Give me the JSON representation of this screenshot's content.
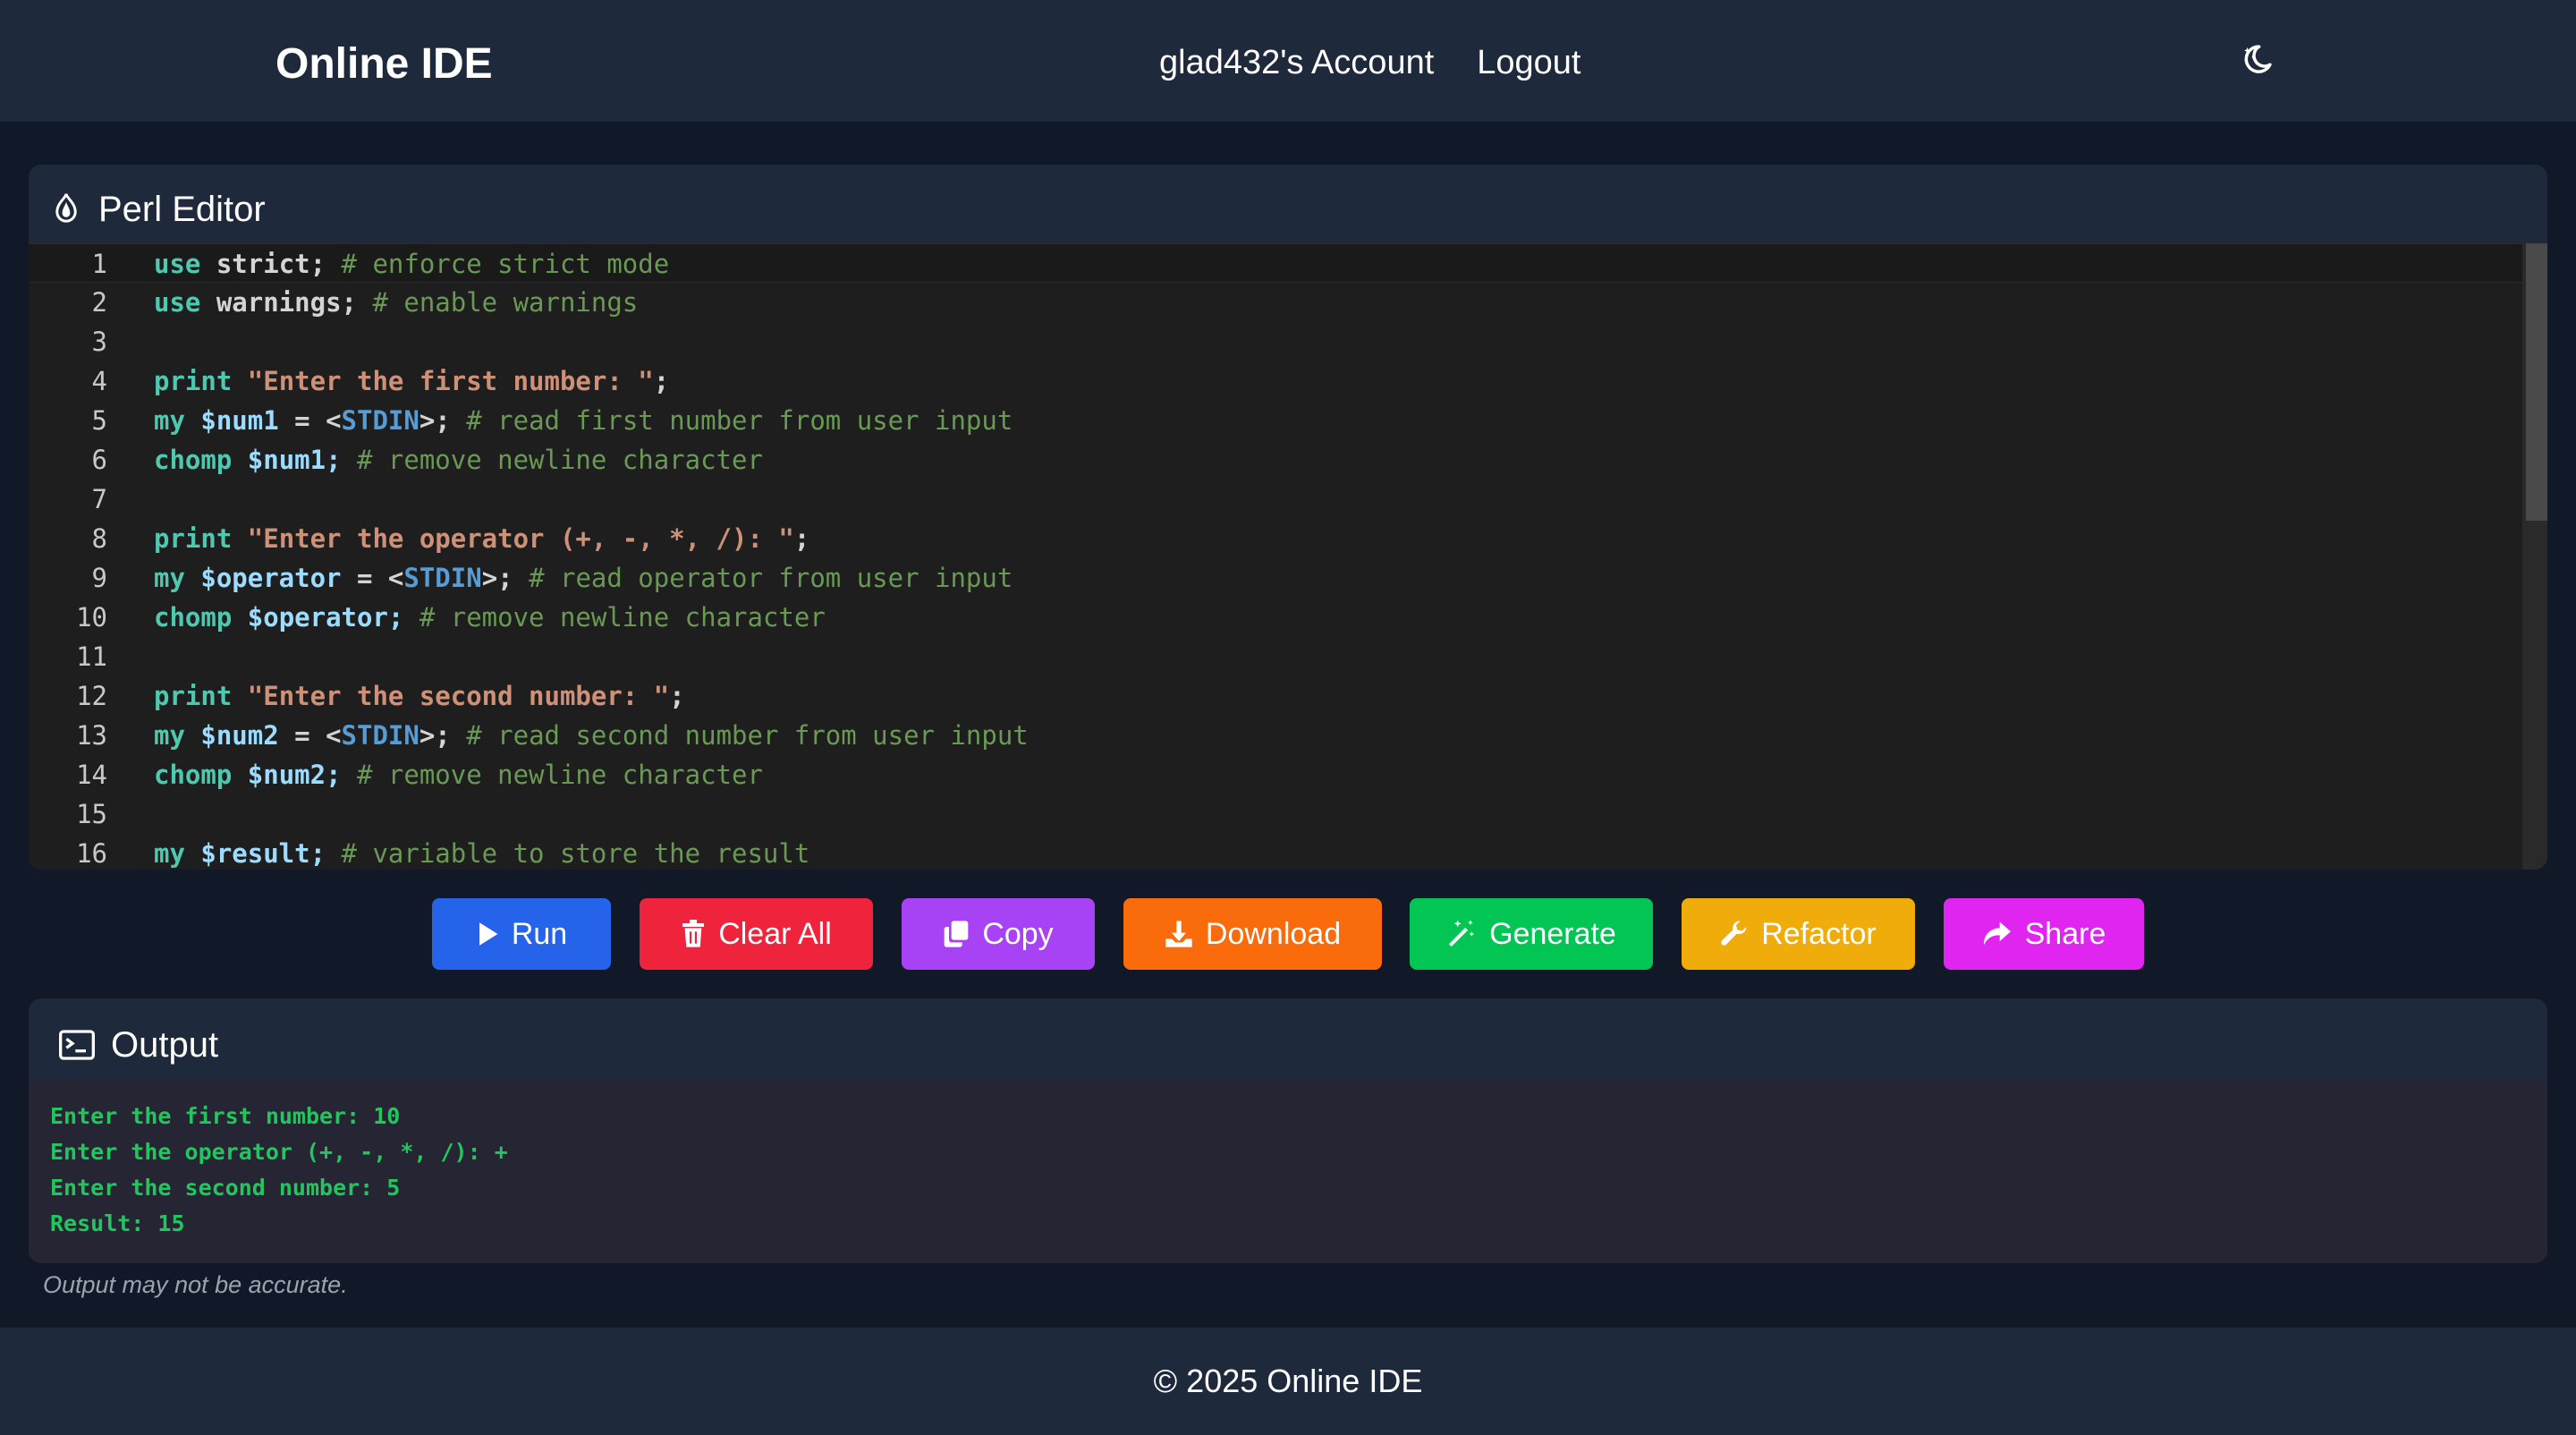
{
  "header": {
    "brand": "Online IDE",
    "account_link": "glad432's Account",
    "logout_link": "Logout",
    "theme_icon": "moon-stars-icon"
  },
  "editor": {
    "title": "Perl Editor",
    "title_icon": "perl-onion-icon",
    "lines": [
      {
        "num": "1",
        "tokens": [
          {
            "t": "use",
            "c": "kw"
          },
          {
            "t": " strict;",
            "c": "plain"
          },
          {
            "t": " # enforce strict mode",
            "c": "cmt"
          }
        ]
      },
      {
        "num": "2",
        "tokens": [
          {
            "t": "use",
            "c": "kw"
          },
          {
            "t": " warnings;",
            "c": "plain"
          },
          {
            "t": " # enable warnings",
            "c": "cmt"
          }
        ]
      },
      {
        "num": "3",
        "tokens": []
      },
      {
        "num": "4",
        "tokens": [
          {
            "t": "print",
            "c": "kw"
          },
          {
            "t": " \"Enter the first number: \"",
            "c": "str"
          },
          {
            "t": ";",
            "c": "plain"
          }
        ]
      },
      {
        "num": "5",
        "tokens": [
          {
            "t": "my",
            "c": "kw"
          },
          {
            "t": " $num1",
            "c": "var"
          },
          {
            "t": " = <",
            "c": "plain"
          },
          {
            "t": "STDIN",
            "c": "fh"
          },
          {
            "t": ">;",
            "c": "plain"
          },
          {
            "t": " # read first number from user input",
            "c": "cmt"
          }
        ]
      },
      {
        "num": "6",
        "tokens": [
          {
            "t": "chomp",
            "c": "kw"
          },
          {
            "t": " $num1;",
            "c": "var"
          },
          {
            "t": " # remove newline character",
            "c": "cmt"
          }
        ]
      },
      {
        "num": "7",
        "tokens": []
      },
      {
        "num": "8",
        "tokens": [
          {
            "t": "print",
            "c": "kw"
          },
          {
            "t": " \"Enter the operator (+, -, *, /): \"",
            "c": "str"
          },
          {
            "t": ";",
            "c": "plain"
          }
        ]
      },
      {
        "num": "9",
        "tokens": [
          {
            "t": "my",
            "c": "kw"
          },
          {
            "t": " $operator",
            "c": "var"
          },
          {
            "t": " = <",
            "c": "plain"
          },
          {
            "t": "STDIN",
            "c": "fh"
          },
          {
            "t": ">;",
            "c": "plain"
          },
          {
            "t": " # read operator from user input",
            "c": "cmt"
          }
        ]
      },
      {
        "num": "10",
        "tokens": [
          {
            "t": "chomp",
            "c": "kw"
          },
          {
            "t": " $operator;",
            "c": "var"
          },
          {
            "t": " # remove newline character",
            "c": "cmt"
          }
        ]
      },
      {
        "num": "11",
        "tokens": []
      },
      {
        "num": "12",
        "tokens": [
          {
            "t": "print",
            "c": "kw"
          },
          {
            "t": " \"Enter the second number: \"",
            "c": "str"
          },
          {
            "t": ";",
            "c": "plain"
          }
        ]
      },
      {
        "num": "13",
        "tokens": [
          {
            "t": "my",
            "c": "kw"
          },
          {
            "t": " $num2",
            "c": "var"
          },
          {
            "t": " = <",
            "c": "plain"
          },
          {
            "t": "STDIN",
            "c": "fh"
          },
          {
            "t": ">;",
            "c": "plain"
          },
          {
            "t": " # read second number from user input",
            "c": "cmt"
          }
        ]
      },
      {
        "num": "14",
        "tokens": [
          {
            "t": "chomp",
            "c": "kw"
          },
          {
            "t": " $num2;",
            "c": "var"
          },
          {
            "t": " # remove newline character",
            "c": "cmt"
          }
        ]
      },
      {
        "num": "15",
        "tokens": []
      },
      {
        "num": "16",
        "tokens": [
          {
            "t": "my",
            "c": "kw"
          },
          {
            "t": " $result;",
            "c": "var"
          },
          {
            "t": " # variable to store the result",
            "c": "cmt"
          }
        ]
      }
    ]
  },
  "toolbar": {
    "run": {
      "label": "Run",
      "icon": "play-icon",
      "color": "#2563eb"
    },
    "clear": {
      "label": "Clear All",
      "icon": "trash-icon",
      "color": "#ef233c"
    },
    "copy": {
      "label": "Copy",
      "icon": "copy-icon",
      "color": "#a742f5"
    },
    "download": {
      "label": "Download",
      "icon": "download-icon",
      "color": "#f96b0b"
    },
    "generate": {
      "label": "Generate",
      "icon": "magic-wand-icon",
      "color": "#02c553"
    },
    "refactor": {
      "label": "Refactor",
      "icon": "wrench-icon",
      "color": "#efac0a"
    },
    "share": {
      "label": "Share",
      "icon": "share-arrow-icon",
      "color": "#e025f0"
    }
  },
  "output": {
    "title": "Output",
    "title_icon": "terminal-icon",
    "lines": [
      "Enter the first number: 10",
      "Enter the operator (+, -, *, /): +",
      "Enter the second number: 5",
      "Result: 15"
    ],
    "disclaimer": "Output may not be accurate."
  },
  "footer": {
    "text": "© 2025 Online IDE"
  }
}
